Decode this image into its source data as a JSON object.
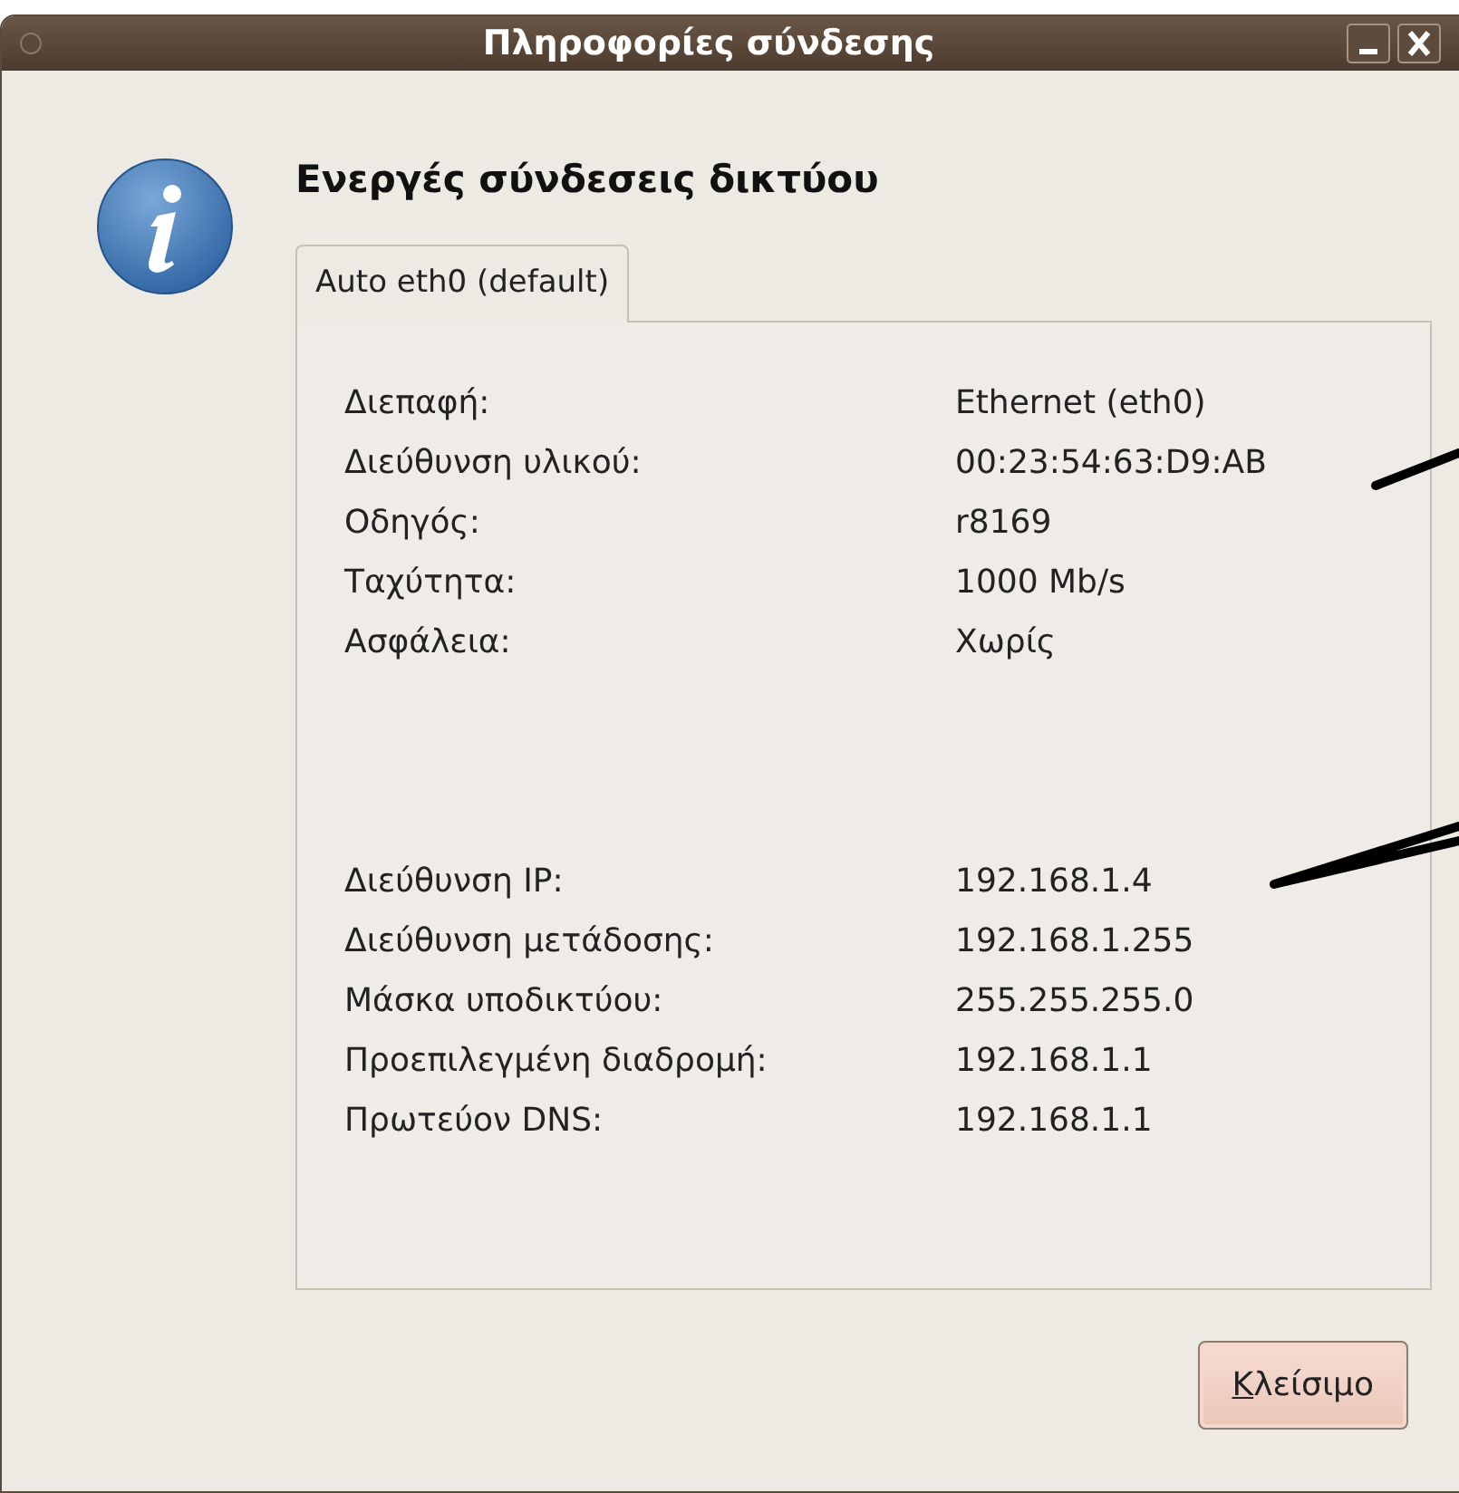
{
  "window": {
    "title": "Πληροφορίες σύνδεσης"
  },
  "heading": "Ενεργές σύνδεσεις δικτύου",
  "tabs": [
    {
      "label": "Auto eth0 (default)",
      "selected": true
    }
  ],
  "sections": [
    {
      "rows": [
        {
          "label": "Διεπαφή:",
          "value": "Ethernet (eth0)"
        },
        {
          "label": "Διεύθυνση υλικού:",
          "value": "00:23:54:63:D9:AB"
        },
        {
          "label": "Οδηγός:",
          "value": "r8169"
        },
        {
          "label": "Ταχύτητα:",
          "value": "1000 Mb/s"
        },
        {
          "label": "Ασφάλεια:",
          "value": "Χωρίς"
        }
      ]
    },
    {
      "rows": [
        {
          "label": "Διεύθυνση IP:",
          "value": "192.168.1.4"
        },
        {
          "label": "Διεύθυνση μετάδοσης:",
          "value": "192.168.1.255"
        },
        {
          "label": "Μάσκα υποδικτύου:",
          "value": "255.255.255.0"
        },
        {
          "label": "Προεπιλεγμένη διαδρομή:",
          "value": "192.168.1.1"
        },
        {
          "label": "Πρωτεύον DNS:",
          "value": "192.168.1.1"
        }
      ]
    }
  ],
  "buttons": [
    {
      "label": "Κλείσιμο"
    }
  ]
}
